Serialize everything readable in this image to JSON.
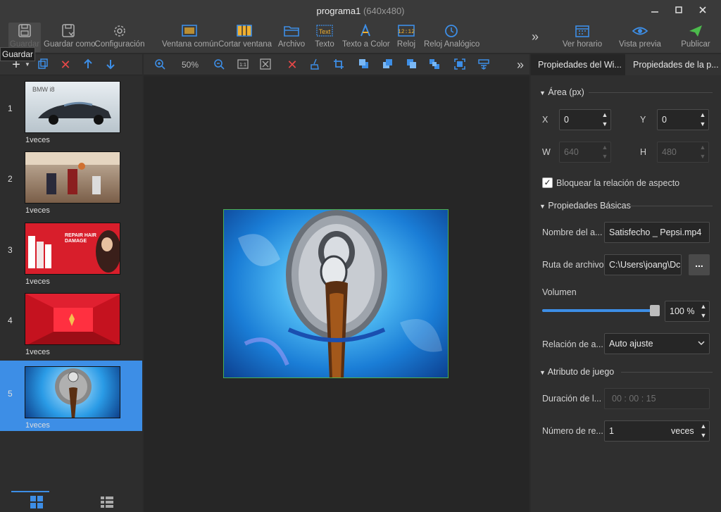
{
  "window": {
    "title": "programa1",
    "resolution": "(640x480)",
    "controls": [
      "minimize",
      "maximize",
      "close"
    ]
  },
  "toolbar": {
    "items": [
      {
        "label": "Guardar",
        "icon": "save-icon"
      },
      {
        "label": "Guardar como",
        "icon": "save-as-icon"
      },
      {
        "label": "Configuración",
        "icon": "gear-icon"
      },
      {
        "label": "Ventana común",
        "icon": "window-icon"
      },
      {
        "label": "Cortar ventana",
        "icon": "split-window-icon"
      },
      {
        "label": "Archivo",
        "icon": "folder-icon"
      },
      {
        "label": "Texto",
        "icon": "text-icon"
      },
      {
        "label": "Texto a Color",
        "icon": "color-text-icon"
      },
      {
        "label": "Reloj",
        "icon": "digital-clock-icon"
      },
      {
        "label": "Reloj Analógico",
        "icon": "analog-clock-icon"
      },
      {
        "label": "Ver horario",
        "icon": "calendar-icon"
      },
      {
        "label": "Vista previa",
        "icon": "eye-icon"
      },
      {
        "label": "Publicar",
        "icon": "send-icon"
      }
    ],
    "more": "»",
    "tooltip": "Guardar"
  },
  "canvas_toolbar": {
    "zoom": "50%",
    "more": "»"
  },
  "playlist": {
    "items": [
      {
        "number": "1",
        "count": "1veces",
        "thumb_text": "BMW i8"
      },
      {
        "number": "2",
        "count": "1veces",
        "thumb_text": ""
      },
      {
        "number": "3",
        "count": "1veces",
        "thumb_text": "REPAIR HAIR DAMAGE"
      },
      {
        "number": "4",
        "count": "1veces",
        "thumb_text": ""
      },
      {
        "number": "5",
        "count": "1veces",
        "thumb_text": ""
      }
    ],
    "selected_index": 4
  },
  "right_panel": {
    "tabs": [
      "Propiedades del Wi...",
      "Propiedades de la p..."
    ],
    "area": {
      "header": "Área (px)",
      "x_label": "X",
      "x_value": "0",
      "y_label": "Y",
      "y_value": "0",
      "w_label": "W",
      "w_value": "640",
      "h_label": "H",
      "h_value": "480"
    },
    "lock_aspect": {
      "label": "Bloquear la relación de aspecto",
      "checked": true
    },
    "basic": {
      "header": "Propiedades Básicas",
      "name_label": "Nombre del a...",
      "name_value": "Satisfecho _ Pepsi.mp4",
      "path_label": "Ruta de archivo",
      "path_value": "C:\\Users\\joang\\Dc",
      "browse_label": "...",
      "volume_label": "Volumen",
      "volume_value": "100 %",
      "volume_fraction": 1.0,
      "aspect_label": "Relación de a...",
      "aspect_value": "Auto ajuste"
    },
    "play": {
      "header": "Atributo de juego",
      "duration_label": "Duración de l...",
      "duration_value": "00 : 00 : 15",
      "repeat_label": "Número de re...",
      "repeat_value": "1",
      "repeat_unit": "veces"
    }
  },
  "colors": {
    "accent": "#3d8ee6",
    "delete_red": "#e84848",
    "publish_green": "#4cbb4c"
  }
}
